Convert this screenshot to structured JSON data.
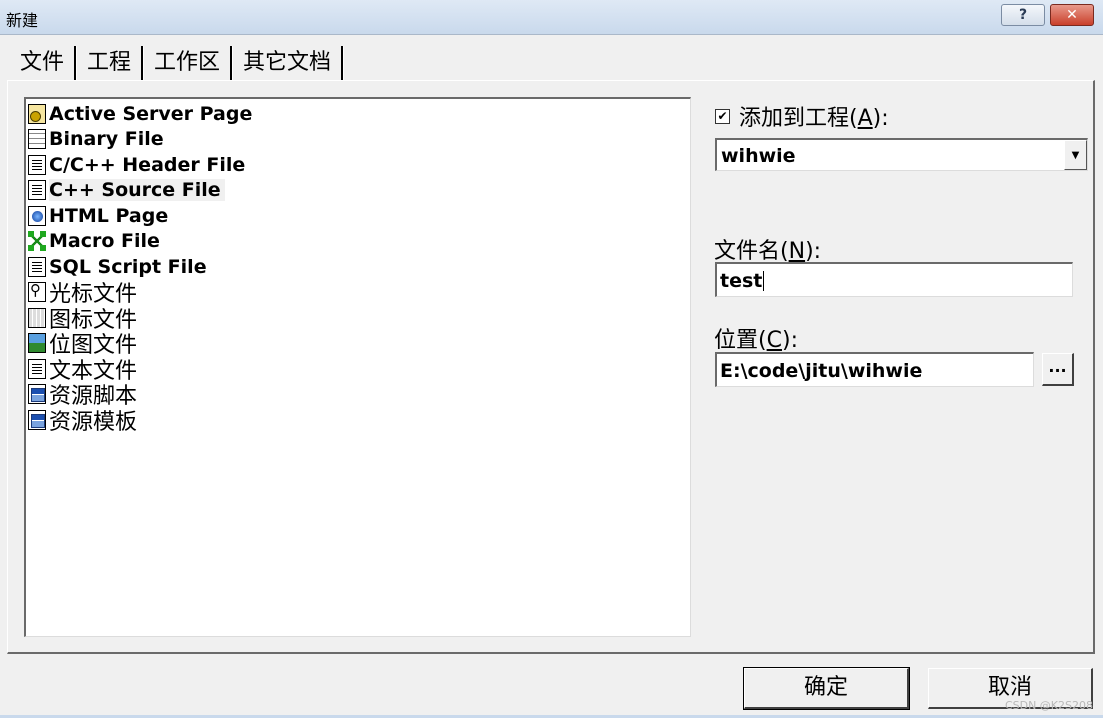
{
  "window": {
    "title": "新建",
    "help_label": "?",
    "close_label": "✕"
  },
  "tabs": [
    {
      "label": "文件"
    },
    {
      "label": "工程"
    },
    {
      "label": "工作区"
    },
    {
      "label": "其它文档"
    }
  ],
  "file_types": [
    {
      "label": "Active Server Page",
      "icon": "asp-page-icon"
    },
    {
      "label": "Binary File",
      "icon": "binary-file-icon"
    },
    {
      "label": "C/C++ Header File",
      "icon": "header-file-icon"
    },
    {
      "label": "C++ Source File",
      "icon": "source-file-icon",
      "selected": true
    },
    {
      "label": "HTML Page",
      "icon": "html-page-icon"
    },
    {
      "label": "Macro File",
      "icon": "macro-file-icon"
    },
    {
      "label": "SQL Script File",
      "icon": "sql-script-icon"
    },
    {
      "label": "光标文件",
      "icon": "cursor-file-icon"
    },
    {
      "label": "图标文件",
      "icon": "icon-file-icon"
    },
    {
      "label": "位图文件",
      "icon": "bitmap-file-icon"
    },
    {
      "label": "文本文件",
      "icon": "text-file-icon"
    },
    {
      "label": "资源脚本",
      "icon": "resource-script-icon"
    },
    {
      "label": "资源模板",
      "icon": "resource-template-icon"
    }
  ],
  "add_to_project": {
    "checked": true,
    "check_glyph": "✔",
    "label": "添加到工程",
    "accel_open": "(",
    "accel_key": "A",
    "accel_close": "):",
    "project": "wihwie",
    "dropdown_glyph": "▼"
  },
  "filename": {
    "label": "文件名",
    "accel_open": "(",
    "accel_key": "N",
    "accel_close": "):",
    "value": "test"
  },
  "location": {
    "label": "位置",
    "accel_open": "(",
    "accel_key": "C",
    "accel_close": "):",
    "value": "E:\\code\\jitu\\wihwie",
    "browse_label": "..."
  },
  "buttons": {
    "ok": "确定",
    "cancel": "取消"
  },
  "watermark": "CSDN @K2S208"
}
